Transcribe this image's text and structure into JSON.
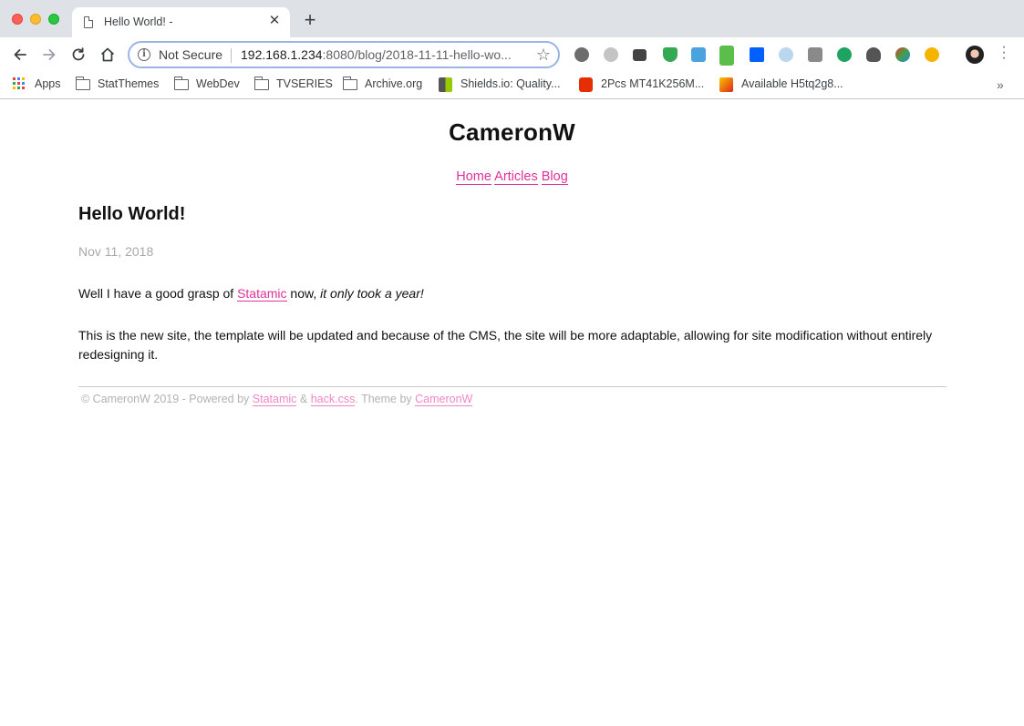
{
  "browser": {
    "tab": {
      "title": "Hello World! -"
    },
    "omnibox": {
      "security": "Not Secure",
      "url_host": "192.168.1.234",
      "url_rest": ":8080/blog/2018-11-11-hello-wo..."
    },
    "extensions": [
      "settings-gear-icon",
      "m-circle-icon",
      "mail-check-icon",
      "shield-check-icon",
      "camera-extension-icon",
      "qr-new-icon",
      "dropbox-icon",
      "swirl-icon",
      "r-square-icon",
      "green-leaf-icon",
      "bulb-icon",
      "colorful-bird-icon",
      "orange-coin-icon"
    ],
    "bookmarks": {
      "apps": "Apps",
      "items": [
        "StatThemes",
        "WebDev",
        "TVSERIES",
        "Archive.org",
        "Shields.io: Quality...",
        "2Pcs MT41K256M...",
        "Available H5tq2g8..."
      ],
      "overflow": "»"
    }
  },
  "site": {
    "title": "CameronW",
    "nav": [
      "Home",
      "Articles",
      "Blog"
    ]
  },
  "post": {
    "title": "Hello World!",
    "date": "Nov 11, 2018",
    "p1_prefix": "Well I have a good grasp of ",
    "p1_link": "Statamic",
    "p1_mid": " now, ",
    "p1_em": "it only took a year!",
    "p2": "This is the new site, the template will be updated and because of the CMS, the site will be more adaptable, allowing for site modification without entirely redesigning it."
  },
  "footer": {
    "prefix": "© CameronW 2019 - Powered by ",
    "link1": "Statamic",
    "amp": " & ",
    "link2": "hack.css",
    "mid": ". Theme by ",
    "link3": "CameronW"
  },
  "colors": {
    "link": "#e0309a",
    "footer_link": "#f086c4",
    "date": "#a9a9a9"
  }
}
